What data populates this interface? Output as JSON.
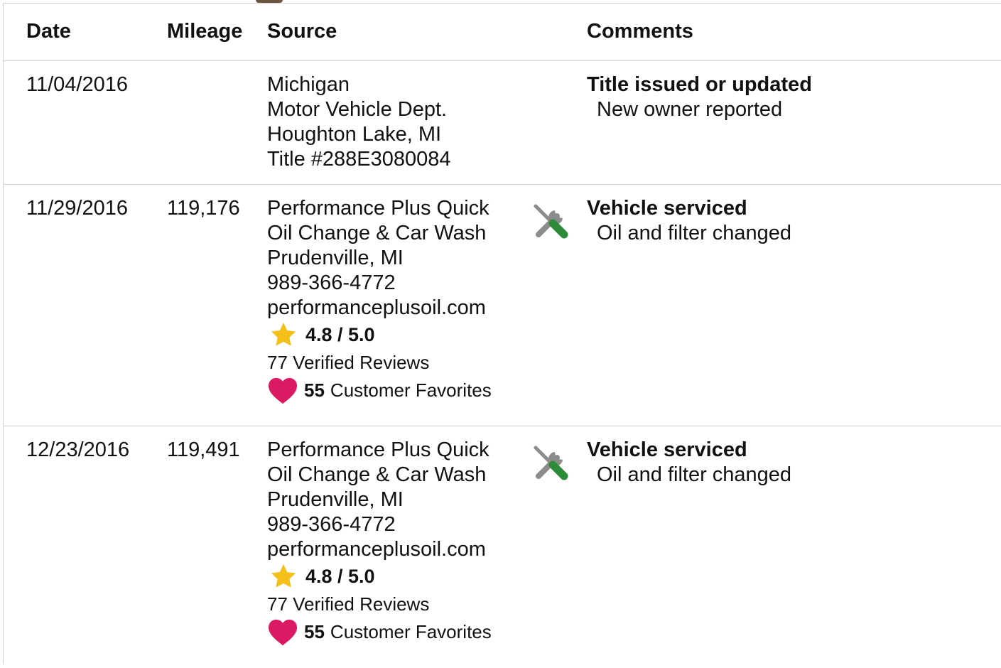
{
  "header": {
    "date": "Date",
    "mileage": "Mileage",
    "source": "Source",
    "comments": "Comments"
  },
  "records": [
    {
      "date": "11/04/2016",
      "mileage": "",
      "source_lines": [
        "Michigan",
        "Motor Vehicle Dept.",
        "Houghton Lake, MI",
        "Title #288E3080084"
      ],
      "icon": "",
      "comment_title": "Title issued or updated",
      "comment_detail": "New owner reported"
    },
    {
      "date": "11/29/2016",
      "mileage": "119,176",
      "source_lines": [
        "Performance Plus Quick",
        "Oil Change & Car Wash",
        "Prudenville, MI",
        "989-366-4772",
        "performanceplusoil.com"
      ],
      "rating": "4.8 / 5.0",
      "reviews": "77 Verified Reviews",
      "favorites_count": "55",
      "favorites_label": "Customer Favorites",
      "icon": "service-tools-icon",
      "comment_title": "Vehicle serviced",
      "comment_detail": "Oil and filter changed"
    },
    {
      "date": "12/23/2016",
      "mileage": "119,491",
      "source_lines": [
        "Performance Plus Quick",
        "Oil Change & Car Wash",
        "Prudenville, MI",
        "989-366-4772",
        "performanceplusoil.com"
      ],
      "rating": "4.8 / 5.0",
      "reviews": "77 Verified Reviews",
      "favorites_count": "55",
      "favorites_label": "Customer Favorites",
      "icon": "service-tools-icon",
      "comment_title": "Vehicle serviced",
      "comment_detail": "Oil and filter changed"
    }
  ],
  "colors": {
    "star": "#F5BF1A",
    "heart": "#DC1A63",
    "wrench": "#8C8C8C",
    "screwdriver_handle": "#2E8B3A"
  }
}
